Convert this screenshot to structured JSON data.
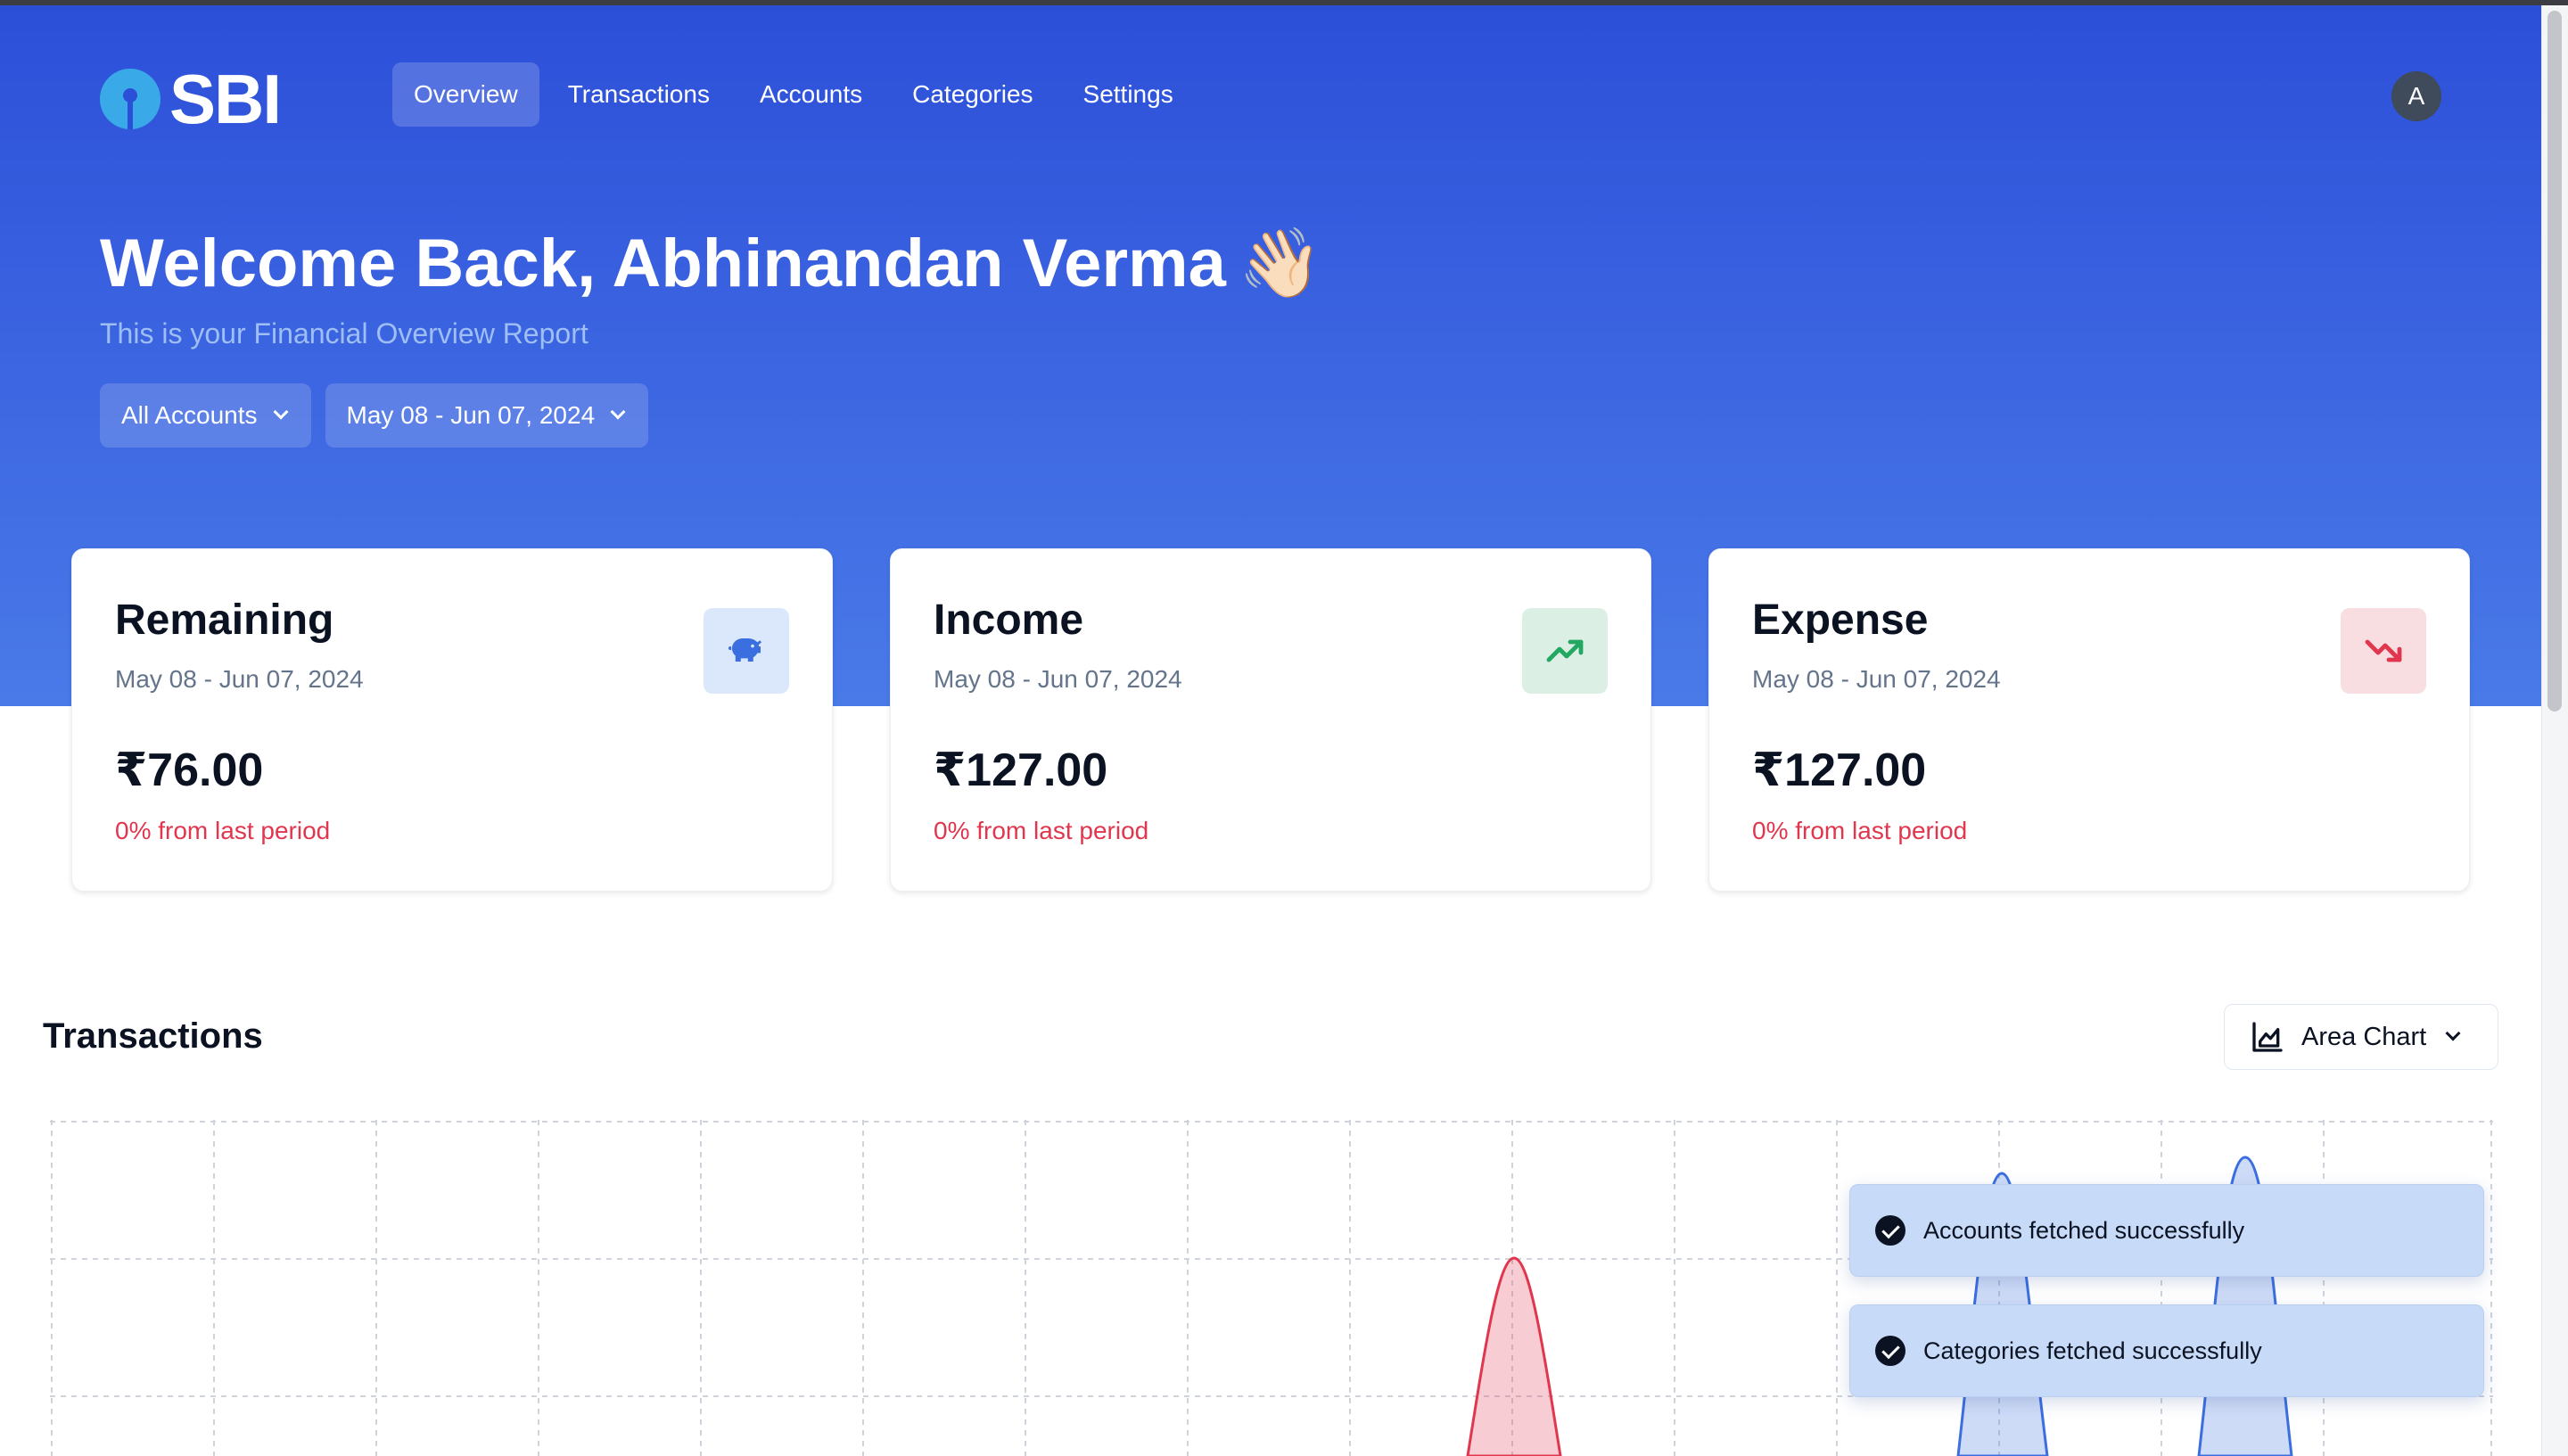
{
  "brand": {
    "logo_text": "SBI",
    "logo_icon": "sbi-keyhole-logo"
  },
  "nav": {
    "items": [
      {
        "label": "Overview",
        "active": true
      },
      {
        "label": "Transactions",
        "active": false
      },
      {
        "label": "Accounts",
        "active": false
      },
      {
        "label": "Categories",
        "active": false
      },
      {
        "label": "Settings",
        "active": false
      }
    ]
  },
  "user": {
    "avatar_initial": "A"
  },
  "welcome": {
    "title": "Welcome Back, Abhinandan Verma",
    "emoji": "👋🏻",
    "subtitle": "This is your Financial Overview Report"
  },
  "filters": {
    "account": "All Accounts",
    "date_range": "May 08 - Jun 07, 2024"
  },
  "cards": [
    {
      "title": "Remaining",
      "range": "May 08 - Jun 07, 2024",
      "amount": "₹76.00",
      "change": "0% from last period",
      "icon": "piggy-bank-icon",
      "icon_bg": "#dbe7fb",
      "icon_color": "#3b6fe0"
    },
    {
      "title": "Income",
      "range": "May 08 - Jun 07, 2024",
      "amount": "₹127.00",
      "change": "0% from last period",
      "icon": "trending-up-icon",
      "icon_bg": "#dcefe4",
      "icon_color": "#22a860"
    },
    {
      "title": "Expense",
      "range": "May 08 - Jun 07, 2024",
      "amount": "₹127.00",
      "change": "0% from last period",
      "icon": "trending-down-icon",
      "icon_bg": "#f8dde1",
      "icon_color": "#e0364e"
    }
  ],
  "transactions": {
    "title": "Transactions",
    "chart_type_label": "Area Chart",
    "chart_type_icon": "area-chart-icon"
  },
  "toasts": [
    {
      "message": "Accounts fetched successfully"
    },
    {
      "message": "Categories fetched successfully"
    }
  ],
  "colors": {
    "hero": "#2c4fd8",
    "expense": "#e0364e",
    "income": "#3b6fe0"
  },
  "chart_data": {
    "type": "area",
    "grid": true,
    "series": [
      {
        "color": "#3b6fe0",
        "peaks_at_column": [
          12,
          13.5
        ]
      },
      {
        "color": "#e0364e",
        "peaks_at_column": [
          9
        ]
      }
    ]
  }
}
